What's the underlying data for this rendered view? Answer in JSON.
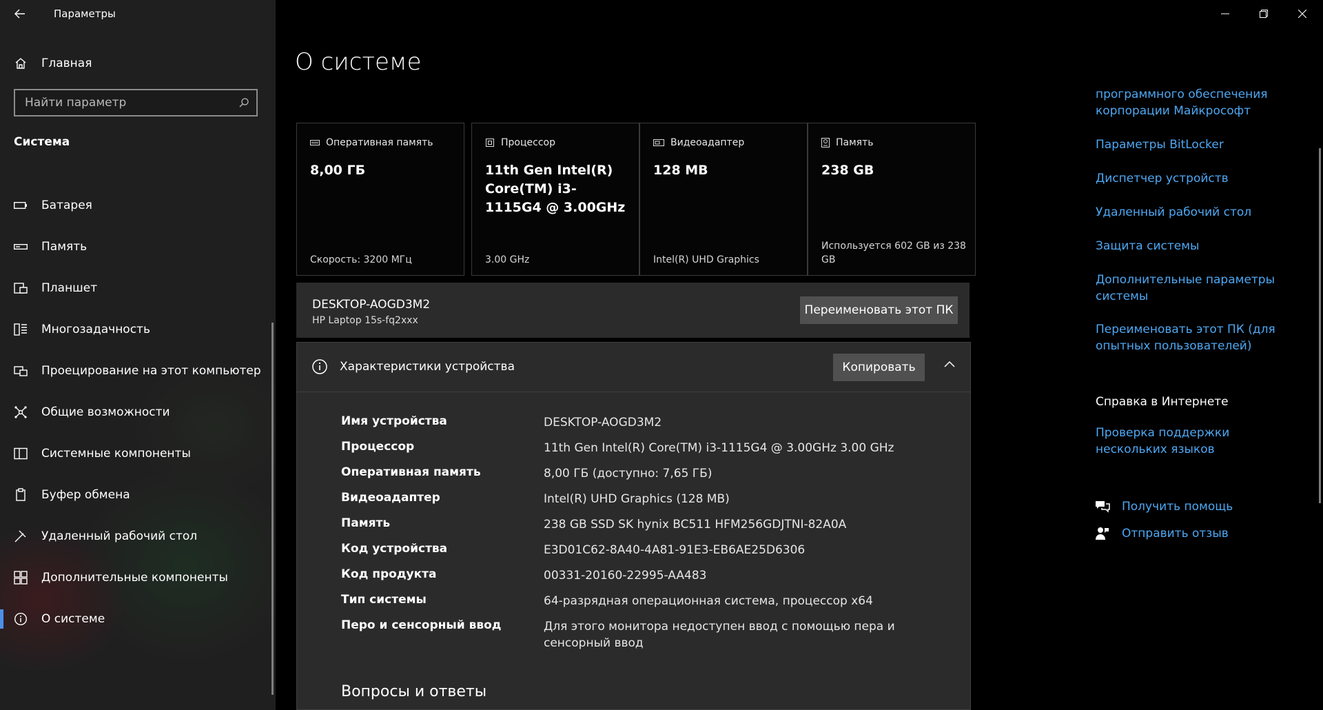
{
  "app": {
    "title": "Параметры"
  },
  "nav": {
    "home_label": "Главная",
    "search_placeholder": "Найти параметр",
    "section_title": "Система",
    "items": [
      {
        "label": "Батарея",
        "icon": "battery-icon"
      },
      {
        "label": "Память",
        "icon": "storage-icon"
      },
      {
        "label": "Планшет",
        "icon": "tablet-icon"
      },
      {
        "label": "Многозадачность",
        "icon": "multitasking-icon"
      },
      {
        "label": "Проецирование на этот компьютер",
        "icon": "projecting-icon"
      },
      {
        "label": "Общие возможности",
        "icon": "shared-experiences-icon"
      },
      {
        "label": "Системные компоненты",
        "icon": "system-components-icon"
      },
      {
        "label": "Буфер обмена",
        "icon": "clipboard-icon"
      },
      {
        "label": "Удаленный рабочий стол",
        "icon": "remote-desktop-icon"
      },
      {
        "label": "Дополнительные компоненты",
        "icon": "optional-features-icon"
      },
      {
        "label": "О системе",
        "icon": "info-icon",
        "selected": true
      }
    ]
  },
  "main": {
    "title": "О системе",
    "cards": [
      {
        "label": "Оперативная память",
        "value": "8,00 ГБ",
        "detail": "Скорость: 3200 МГц",
        "icon": "ram-icon"
      },
      {
        "label": "Процессор",
        "value": "11th Gen Intel(R) Core(TM) i3-1115G4 @ 3.00GHz",
        "detail": "3.00 GHz",
        "icon": "cpu-icon"
      },
      {
        "label": "Видеоадаптер",
        "value": "128 MB",
        "detail": "Intel(R) UHD Graphics",
        "icon": "gpu-icon"
      },
      {
        "label": "Память",
        "value": "238 GB",
        "detail": "Используется 602 GB из 238 GB",
        "icon": "disk-icon"
      }
    ],
    "device": {
      "name": "DESKTOP-AOGD3M2",
      "model": "HP Laptop 15s-fq2xxx",
      "rename_button": "Переименовать этот ПК"
    },
    "specs": {
      "title": "Характеристики устройства",
      "copy_button": "Копировать",
      "rows": [
        {
          "key": "Имя устройства",
          "value": "DESKTOP-AOGD3M2"
        },
        {
          "key": "Процессор",
          "value": "11th Gen Intel(R) Core(TM) i3-1115G4 @ 3.00GHz   3.00 GHz"
        },
        {
          "key": "Оперативная память",
          "value": "8,00 ГБ (доступно: 7,65 ГБ)"
        },
        {
          "key": "Видеоадаптер",
          "value": "Intel(R) UHD Graphics (128 MB)"
        },
        {
          "key": "Память",
          "value": "238 GB SSD SK hynix BC511 HFM256GDJTNI-82A0A"
        },
        {
          "key": "Код устройства",
          "value": "E3D01C62-8A40-4A81-91E3-EB6AE25D6306"
        },
        {
          "key": "Код продукта",
          "value": "00331-20160-22995-AA483"
        },
        {
          "key": "Тип системы",
          "value": "64-разрядная операционная система, процессор x64"
        },
        {
          "key": "Перо и сенсорный ввод",
          "value": "Для этого монитора недоступен ввод с помощью пера и сенсорный ввод"
        }
      ]
    },
    "faq_title": "Вопросы и ответы"
  },
  "related": {
    "links": [
      "программного обеспечения корпорации Майкрософт",
      "Параметры BitLocker",
      "Диспетчер устройств",
      "Удаленный рабочий стол",
      "Защита системы",
      "Дополнительные параметры системы",
      "Переименовать этот ПК (для опытных пользователей)"
    ],
    "web_help_title": "Справка в Интернете",
    "web_help_link": "Проверка поддержки нескольких языков",
    "get_help": "Получить помощь",
    "feedback": "Отправить отзыв"
  },
  "colors": {
    "accent": "#4d8fe8",
    "link": "#4ea7f2",
    "sidebar_bg": "#201f20",
    "panel_bg": "#2b2b2b"
  }
}
